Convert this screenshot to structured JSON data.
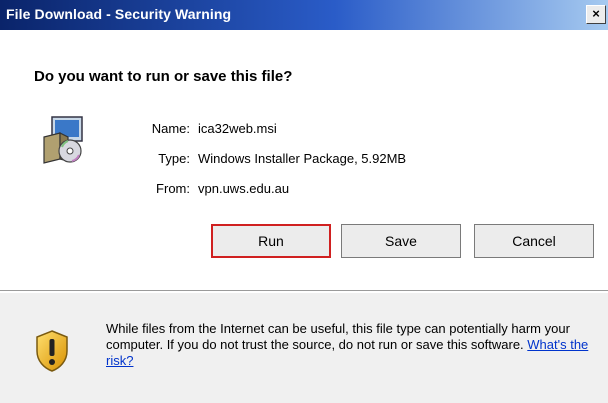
{
  "window": {
    "title": "File Download - Security Warning",
    "close_label": "×"
  },
  "prompt": {
    "question": "Do you want to run or save this file?"
  },
  "file_info": {
    "name_label": "Name:",
    "name_value": "ica32web.msi",
    "type_label": "Type:",
    "type_value": "Windows Installer Package, 5.92MB",
    "from_label": "From:",
    "from_value": "vpn.uws.edu.au",
    "icon": "installer-package-icon"
  },
  "buttons": {
    "run_label": "Run",
    "save_label": "Save",
    "cancel_label": "Cancel"
  },
  "warning": {
    "icon": "shield-warning-icon",
    "text": "While files from the Internet can be useful, this file type can potentially harm your computer. If you do not trust the source, do not run or save this software. ",
    "link_text": "What's the risk?"
  },
  "colors": {
    "title_bar_start": "#0a246a",
    "title_bar_end": "#a6caf0",
    "run_highlight": "#d02020",
    "link": "#0033cc"
  }
}
